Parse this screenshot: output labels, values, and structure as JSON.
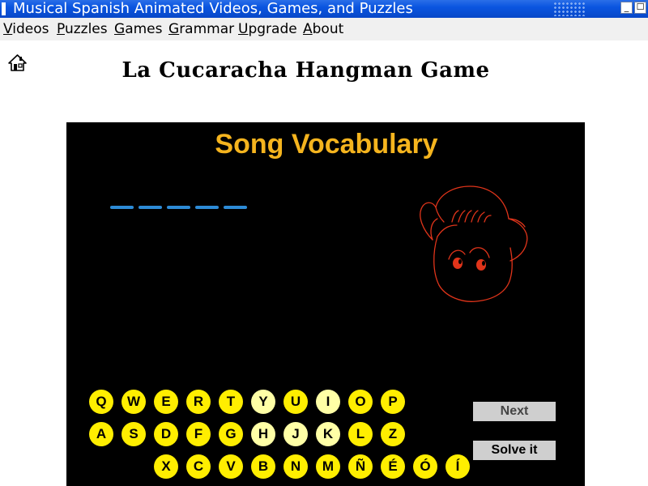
{
  "window": {
    "title": "Musical Spanish Animated Videos, Games, and Puzzles",
    "minimize_glyph": "_",
    "maximize_glyph": "☐"
  },
  "menu": {
    "items": [
      {
        "label": "Videos"
      },
      {
        "label": "Puzzles"
      },
      {
        "label": "Games"
      },
      {
        "label": "Grammar"
      },
      {
        "label": "Upgrade"
      },
      {
        "label": "About"
      }
    ]
  },
  "page": {
    "title": "La Cucaracha Hangman Game",
    "home_icon": "home-icon"
  },
  "game": {
    "category_title": "Song Vocabulary",
    "blank_count": 5,
    "colors": {
      "background": "#000000",
      "title": "#f5b41e",
      "blanks": "#2d8bd6",
      "key": "#ffee00",
      "key_used": "#ffffa6",
      "face_outline": "#e0341a"
    },
    "keyboard": {
      "rows": [
        [
          {
            "letter": "Q",
            "used": false
          },
          {
            "letter": "W",
            "used": false
          },
          {
            "letter": "E",
            "used": false
          },
          {
            "letter": "R",
            "used": false
          },
          {
            "letter": "T",
            "used": false
          },
          {
            "letter": "Y",
            "used": true
          },
          {
            "letter": "U",
            "used": false
          },
          {
            "letter": "I",
            "used": true
          },
          {
            "letter": "O",
            "used": false
          },
          {
            "letter": "P",
            "used": false
          }
        ],
        [
          {
            "letter": "A",
            "used": false
          },
          {
            "letter": "S",
            "used": false
          },
          {
            "letter": "D",
            "used": false
          },
          {
            "letter": "F",
            "used": false
          },
          {
            "letter": "G",
            "used": false
          },
          {
            "letter": "H",
            "used": true
          },
          {
            "letter": "J",
            "used": true
          },
          {
            "letter": "K",
            "used": true
          },
          {
            "letter": "L",
            "used": false
          },
          {
            "letter": "Z",
            "used": false
          }
        ],
        [
          {
            "letter": "X",
            "used": false
          },
          {
            "letter": "C",
            "used": false
          },
          {
            "letter": "V",
            "used": false
          },
          {
            "letter": "B",
            "used": false
          },
          {
            "letter": "N",
            "used": false
          },
          {
            "letter": "M",
            "used": false
          },
          {
            "letter": "Ñ",
            "used": false
          },
          {
            "letter": "É",
            "used": false
          },
          {
            "letter": "Ó",
            "used": false
          },
          {
            "letter": "Í",
            "used": false
          }
        ]
      ]
    },
    "buttons": {
      "next_label": "Next",
      "solve_label": "Solve it"
    }
  }
}
